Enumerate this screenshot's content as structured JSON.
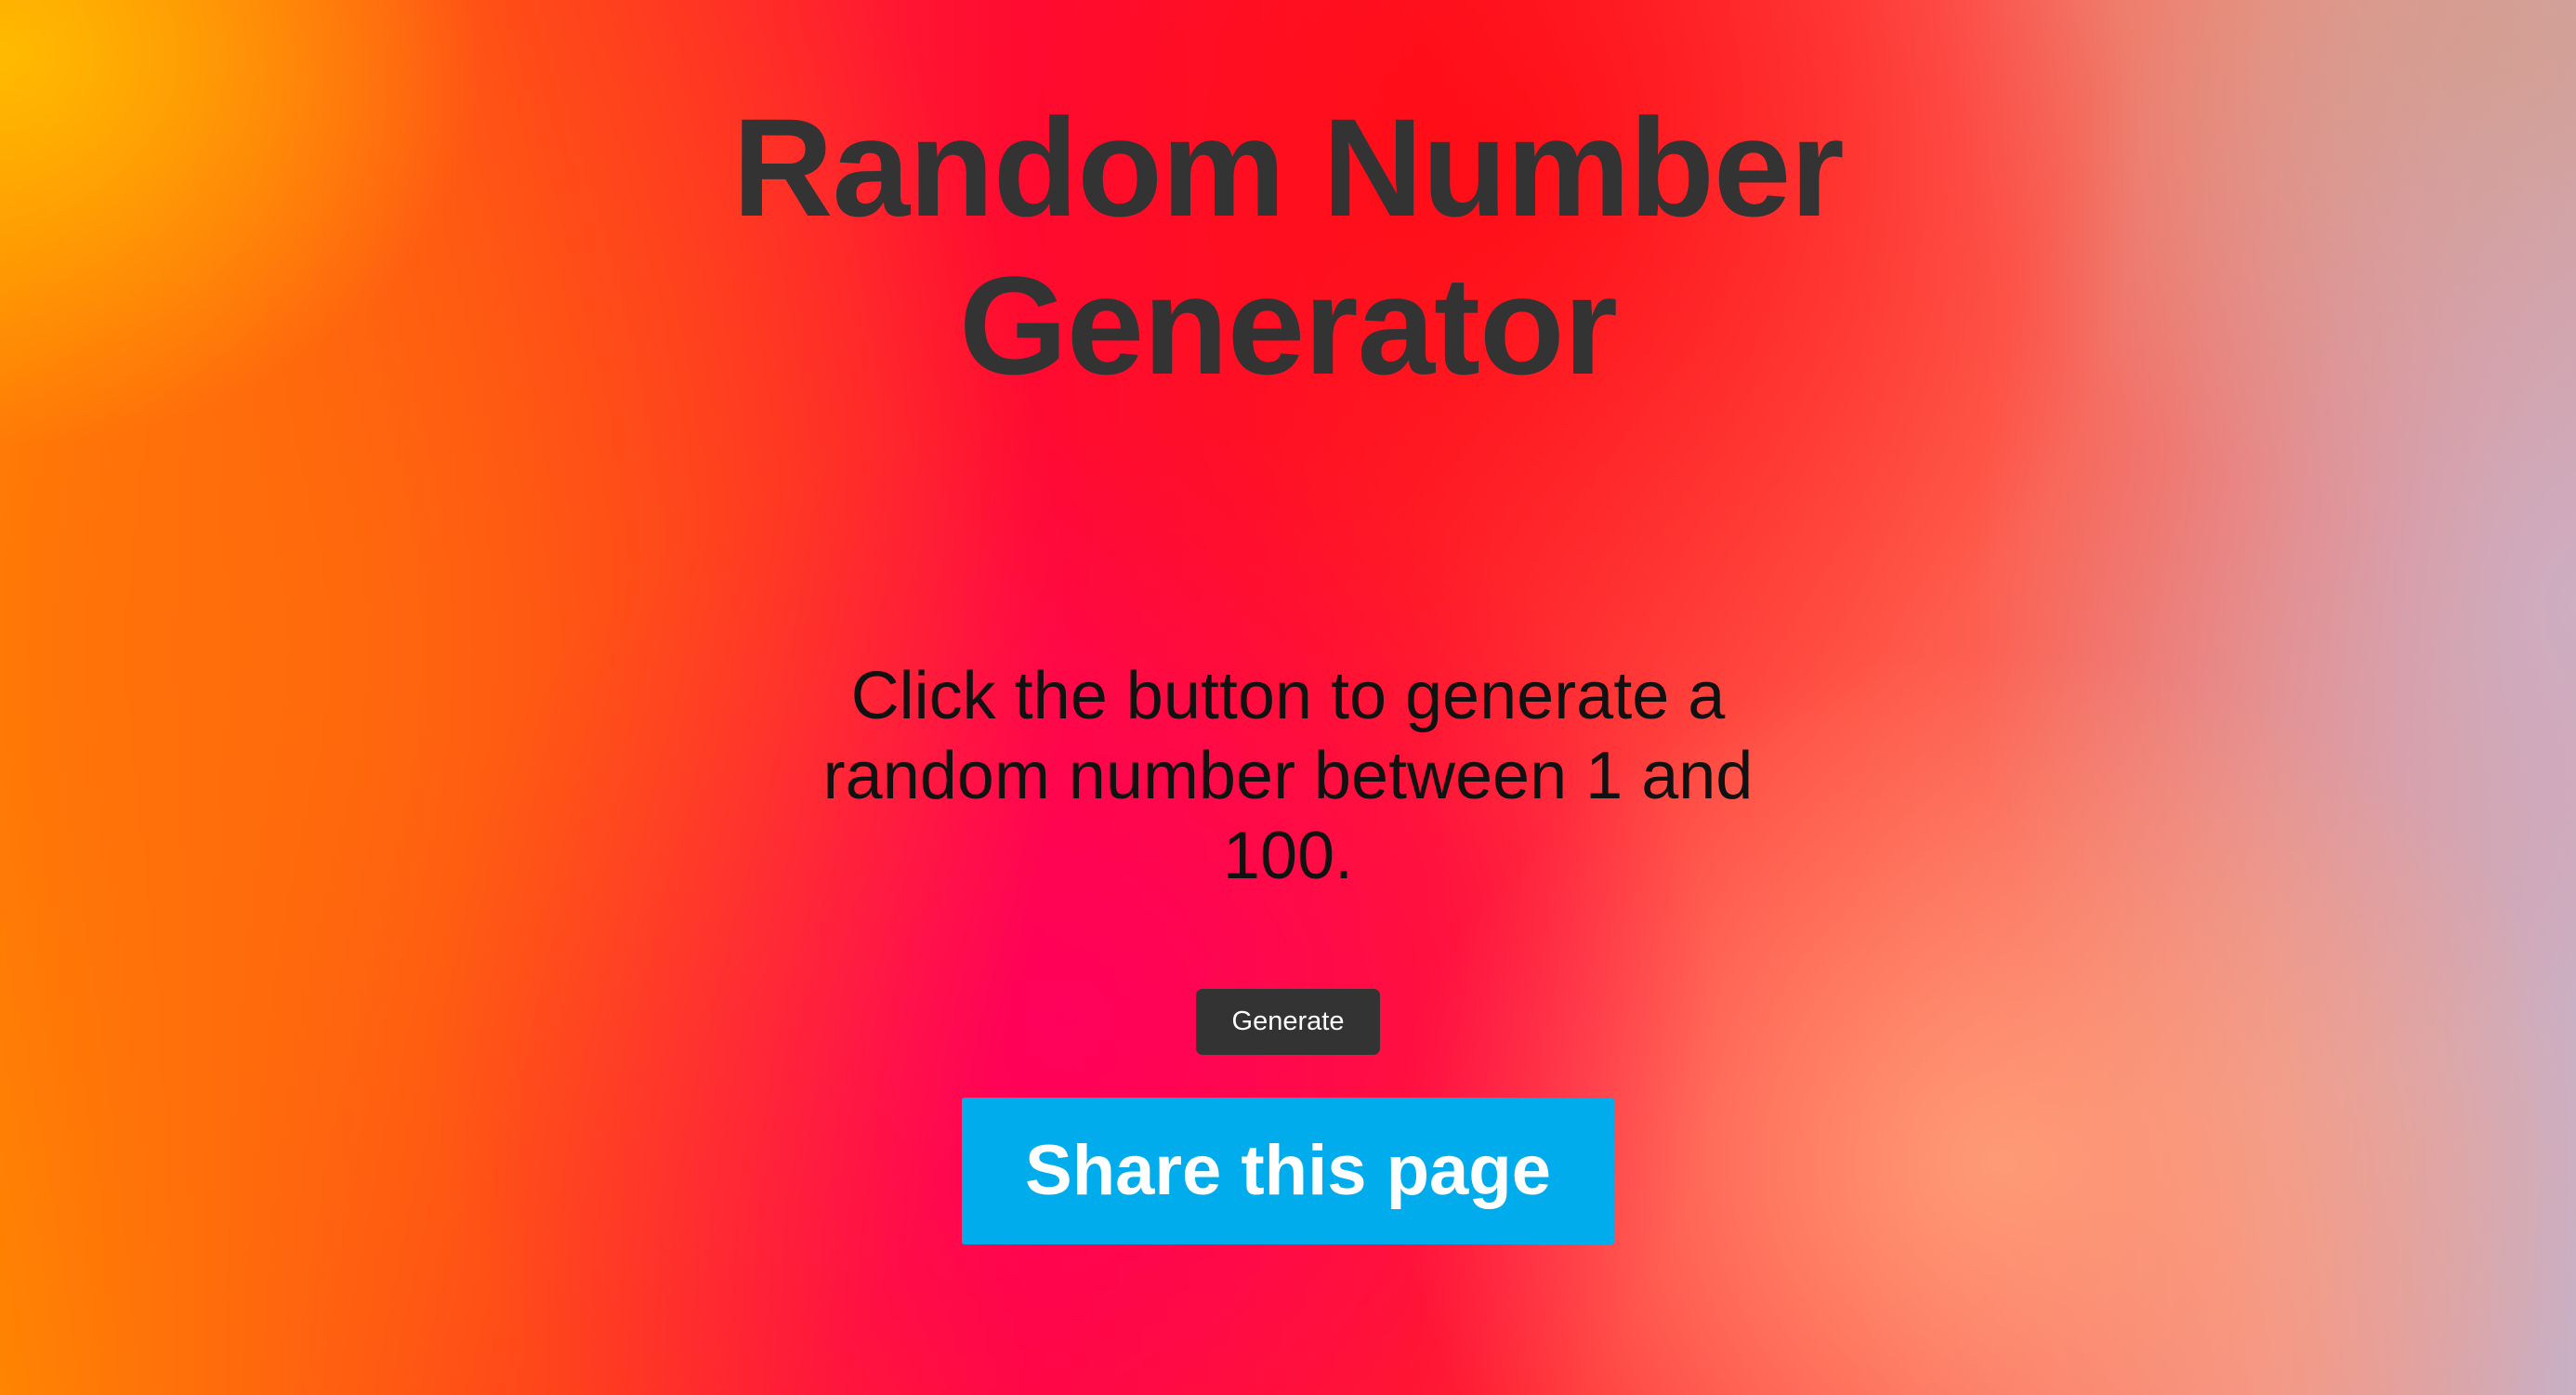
{
  "page": {
    "title": "Random Number Generator",
    "description": "Click the button to generate a random number between 1 and 100."
  },
  "buttons": {
    "generate_label": "Generate",
    "share_label": "Share this page"
  },
  "colors": {
    "title_text": "#333333",
    "description_text": "#111111",
    "generate_button_bg": "#333333",
    "generate_button_text": "#ffffff",
    "share_button_bg": "#00aceb",
    "share_button_text": "#ffffff"
  }
}
